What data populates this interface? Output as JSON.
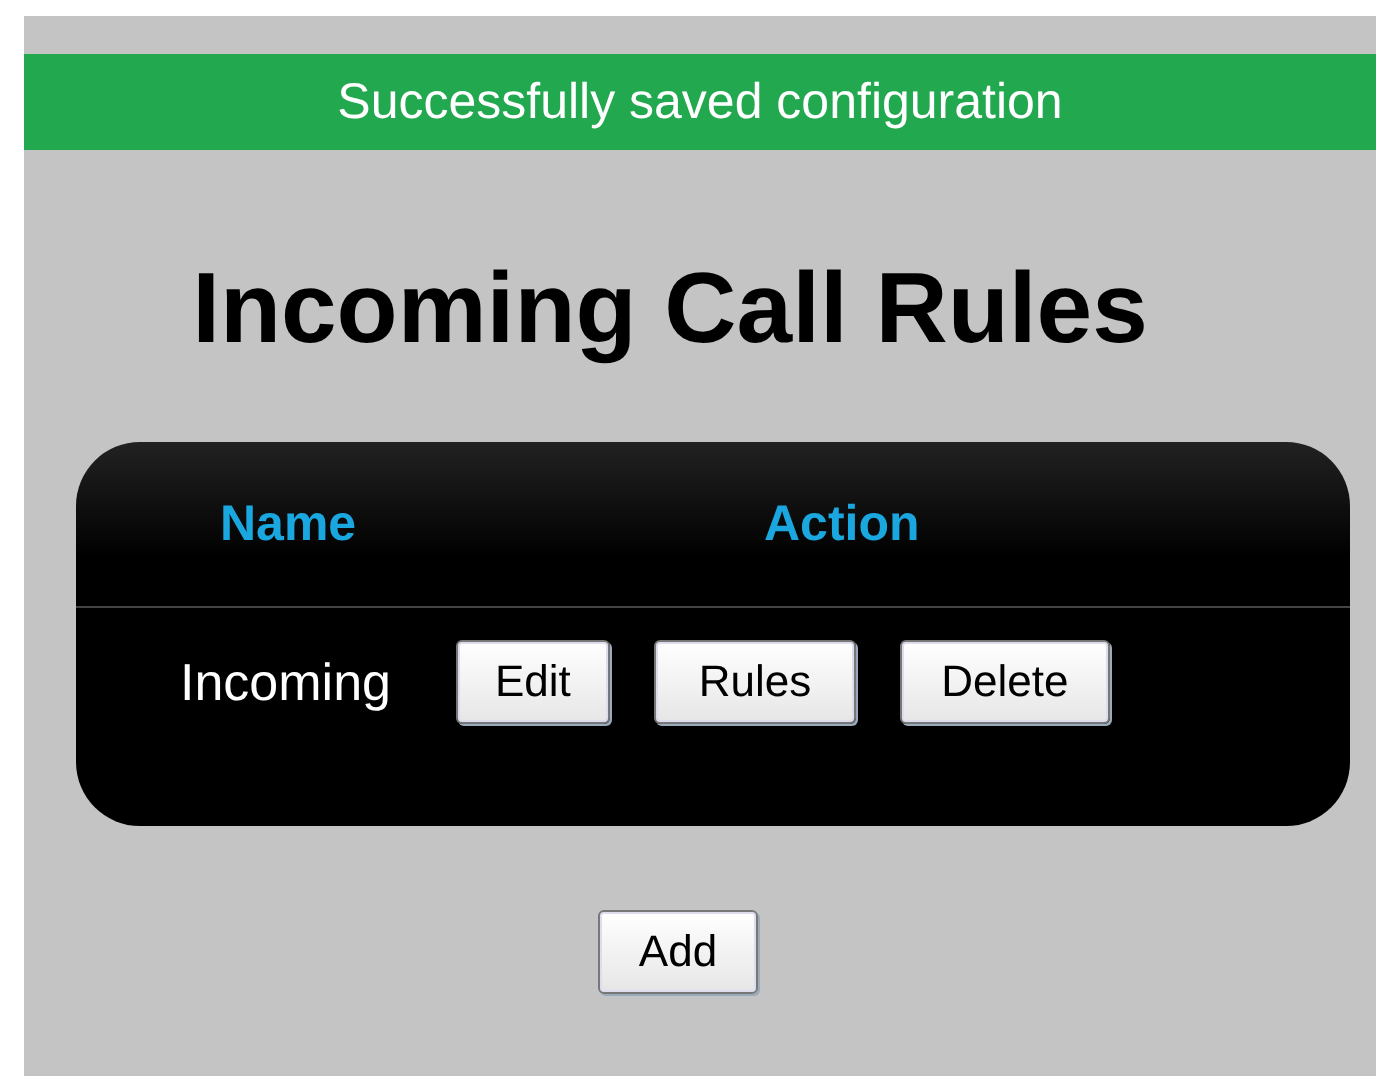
{
  "banner": {
    "text": "Successfully saved configuration"
  },
  "title": "Incoming Call Rules",
  "table": {
    "columns": [
      "Name",
      "Action"
    ],
    "rows": [
      {
        "name": "Incoming",
        "actions": [
          "Edit",
          "Rules",
          "Delete"
        ]
      }
    ]
  },
  "buttons": [
    "Add"
  ]
}
